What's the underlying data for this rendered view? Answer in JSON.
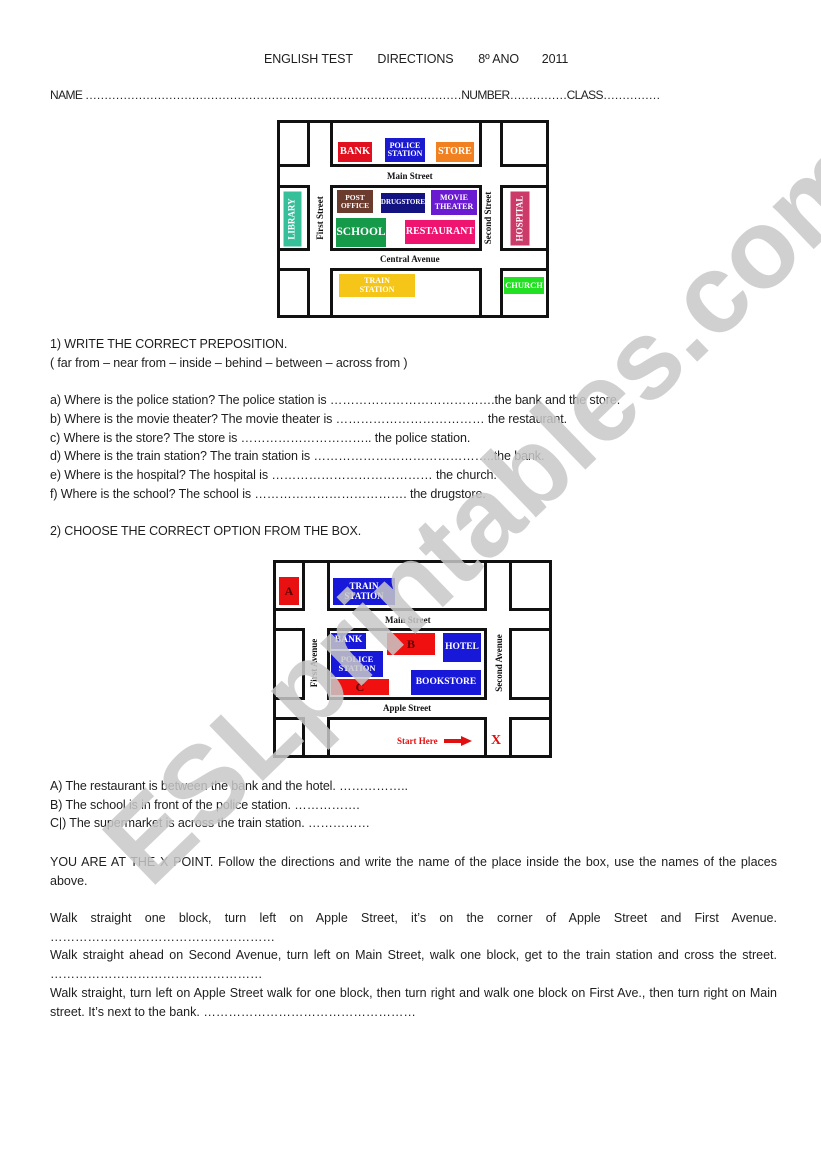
{
  "header": {
    "title_parts": [
      "ENGLISH TEST",
      "DIRECTIONS",
      "8º ANO",
      "2011"
    ],
    "name_line": "NAME ………………………………………………………………………………………NUMBER……………CLASS……………"
  },
  "map1": {
    "streets": {
      "main": "Main Street",
      "central": "Central Avenue",
      "first": "First Street",
      "second": "Second Street"
    },
    "places": [
      {
        "label": "BANK",
        "color": "#e0101e"
      },
      {
        "label": "POLICE STATION",
        "color": "#1a1ad0"
      },
      {
        "label": "STORE",
        "color": "#f08020"
      },
      {
        "label": "POST OFFICE",
        "color": "#6b3b2e"
      },
      {
        "label": "DRUGSTORE",
        "color": "#121280"
      },
      {
        "label": "MOVIE THEATER",
        "color": "#6a1ad0"
      },
      {
        "label": "SCHOOL",
        "color": "#159a4a"
      },
      {
        "label": "RESTAURANT",
        "color": "#ee1470"
      },
      {
        "label": "LIBRARY",
        "color": "#36c09a"
      },
      {
        "label": "HOSPITAL",
        "color": "#cc3a6a"
      },
      {
        "label": "TRAIN STATION",
        "color": "#f5c518"
      },
      {
        "label": "CHURCH",
        "color": "#22e022"
      }
    ]
  },
  "section1": {
    "heading": "1) WRITE THE CORRECT PREPOSITION.",
    "options": "( far from – near from – inside – behind – between – across from )",
    "questions": [
      "a) Where is the police station? The police station is ………………………………….the bank and the store.",
      "b) Where is the movie theater? The movie theater is ……………………………… the restaurant.",
      "c) Where is the store? The store is ………………………….. the police station.",
      "d) Where is the train station? The train station is ……………………………………..the bank.",
      "e) Where is the hospital? The hospital is ………………………………… the church.",
      "f) Where is the school? The school is ………………………………. the drugstore."
    ]
  },
  "section2": {
    "heading": "2) CHOOSE THE CORRECT OPTION FROM THE BOX."
  },
  "map2": {
    "streets": {
      "main": "Main Street",
      "apple": "Apple Street",
      "first": "First Avenue",
      "second": "Second Avenue"
    },
    "places": [
      {
        "label": "A",
        "color": "#e81010"
      },
      {
        "label": "TRAIN STATION",
        "color": "#1818d8"
      },
      {
        "label": "BANK",
        "color": "#1818d8"
      },
      {
        "label": "B",
        "color": "#f01010"
      },
      {
        "label": "HOTEL",
        "color": "#1818d8"
      },
      {
        "label": "POLICE STATION",
        "color": "#1818d8"
      },
      {
        "label": "C",
        "color": "#f01010"
      },
      {
        "label": "BOOKSTORE",
        "color": "#1818d8"
      }
    ],
    "start_label": "Start Here",
    "x_mark": "X",
    "accent": "#e01010"
  },
  "section2_items": [
    "A) The restaurant is between the bank and the hotel. ……………..",
    "B) The school is in front of the police station. …………….",
    "C|) The supermarket is across the train station. ……………"
  ],
  "section3": {
    "instructions": "YOU ARE AT THE X POINT. Follow the directions and write the name of the place inside the box, use the names of the places above.",
    "directions": [
      "Walk  straight one block, turn left on Apple Street, it’s on the corner of Apple Street and First Avenue. ………………………………………………",
      "Walk  straight ahead on Second Avenue, turn left on Main Street, walk one block, get to the train station and cross the street. ……………………………………………",
      "Walk straight, turn left on Apple Street walk for one block, then turn right and walk one block on First Ave., then turn right on Main street. It’s next to the bank. ……………………………………………"
    ]
  },
  "watermark": {
    "text": "ESLprintables.com",
    "color": "#c8c8c8"
  }
}
